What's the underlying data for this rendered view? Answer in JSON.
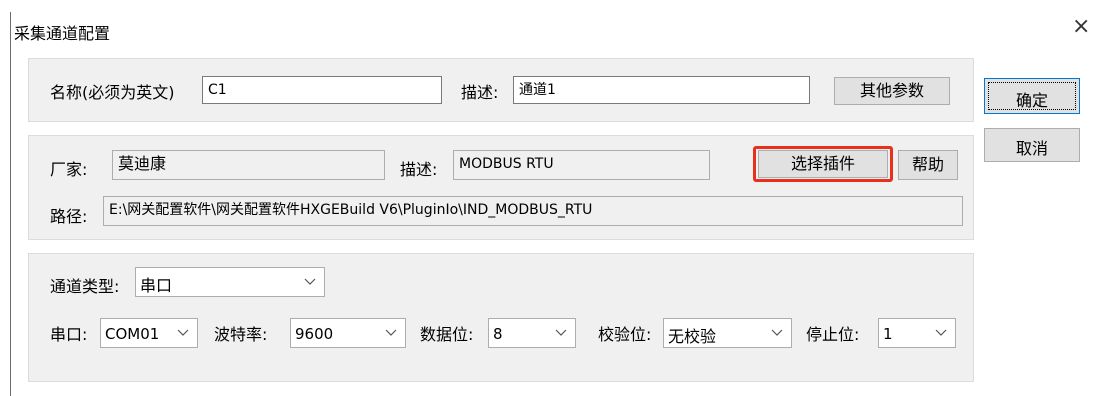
{
  "window": {
    "title": "采集通道配置",
    "close_glyph": "×"
  },
  "channel": {
    "name_label": "名称(必须为英文)",
    "name_value": "C1",
    "desc_label": "描述:",
    "desc_value": "通道1",
    "other_params_label": "其他参数"
  },
  "dialog_buttons": {
    "ok_label": "确定",
    "cancel_label": "取消"
  },
  "plugin": {
    "vendor_label": "厂家:",
    "vendor_value": "莫迪康",
    "desc_label": "描述:",
    "desc_value": "MODBUS RTU",
    "select_label": "选择插件",
    "help_label": "帮助",
    "path_label": "路径:",
    "path_value": "E:\\网关配置软件\\网关配置软件HXGEBuild V6\\PluginIo\\IND_MODBUS_RTU",
    "highlight_color": "#e8301c"
  },
  "serial": {
    "type_label": "通道类型:",
    "type_value": "串口",
    "port_label": "串口:",
    "port_value": "COM01",
    "baud_label": "波特率:",
    "baud_value": "9600",
    "databits_label": "数据位:",
    "databits_value": "8",
    "parity_label": "校验位:",
    "parity_value": "无校验",
    "stopbits_label": "停止位:",
    "stopbits_value": "1"
  }
}
